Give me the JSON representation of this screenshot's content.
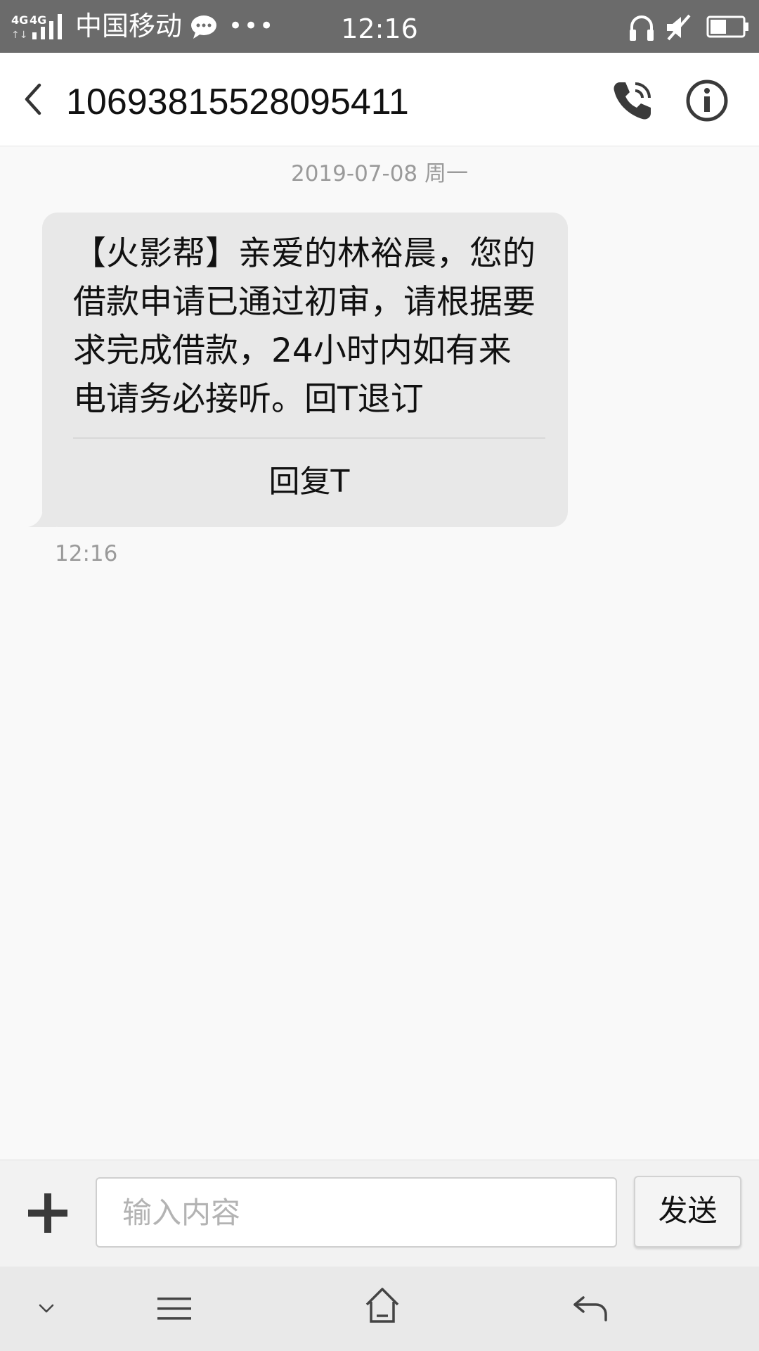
{
  "status_bar": {
    "network": "4G 4G",
    "carrier": "中国移动",
    "more": "•••",
    "time": "12:16",
    "icons": [
      "signal-icon",
      "chat-notification-icon",
      "headphone-icon",
      "mute-icon",
      "battery-icon"
    ]
  },
  "header": {
    "title": "10693815528095411",
    "back_icon": "chevron-left-icon",
    "call_icon": "phone-icon",
    "info_icon": "info-icon"
  },
  "conversation": {
    "date": "2019-07-08 周一",
    "message": {
      "text": "【火影帮】亲爱的林裕晨，您的借款申请已通过初审，请根据要求完成借款，24小时内如有来电请务必接听。回T退订",
      "reply_action": "回复T",
      "time": "12:16"
    }
  },
  "input_bar": {
    "placeholder": "输入内容",
    "send_label": "发送",
    "add_icon": "plus-icon"
  },
  "nav_bar": {
    "icons": [
      "chevron-down-icon",
      "menu-icon",
      "home-icon",
      "back-arrow-icon"
    ]
  },
  "colors": {
    "status_bar_bg": "#6b6b6b",
    "bubble_bg": "#e8e8e8",
    "page_bg": "#f9f9f9",
    "nav_bg": "#e9e9e9"
  }
}
